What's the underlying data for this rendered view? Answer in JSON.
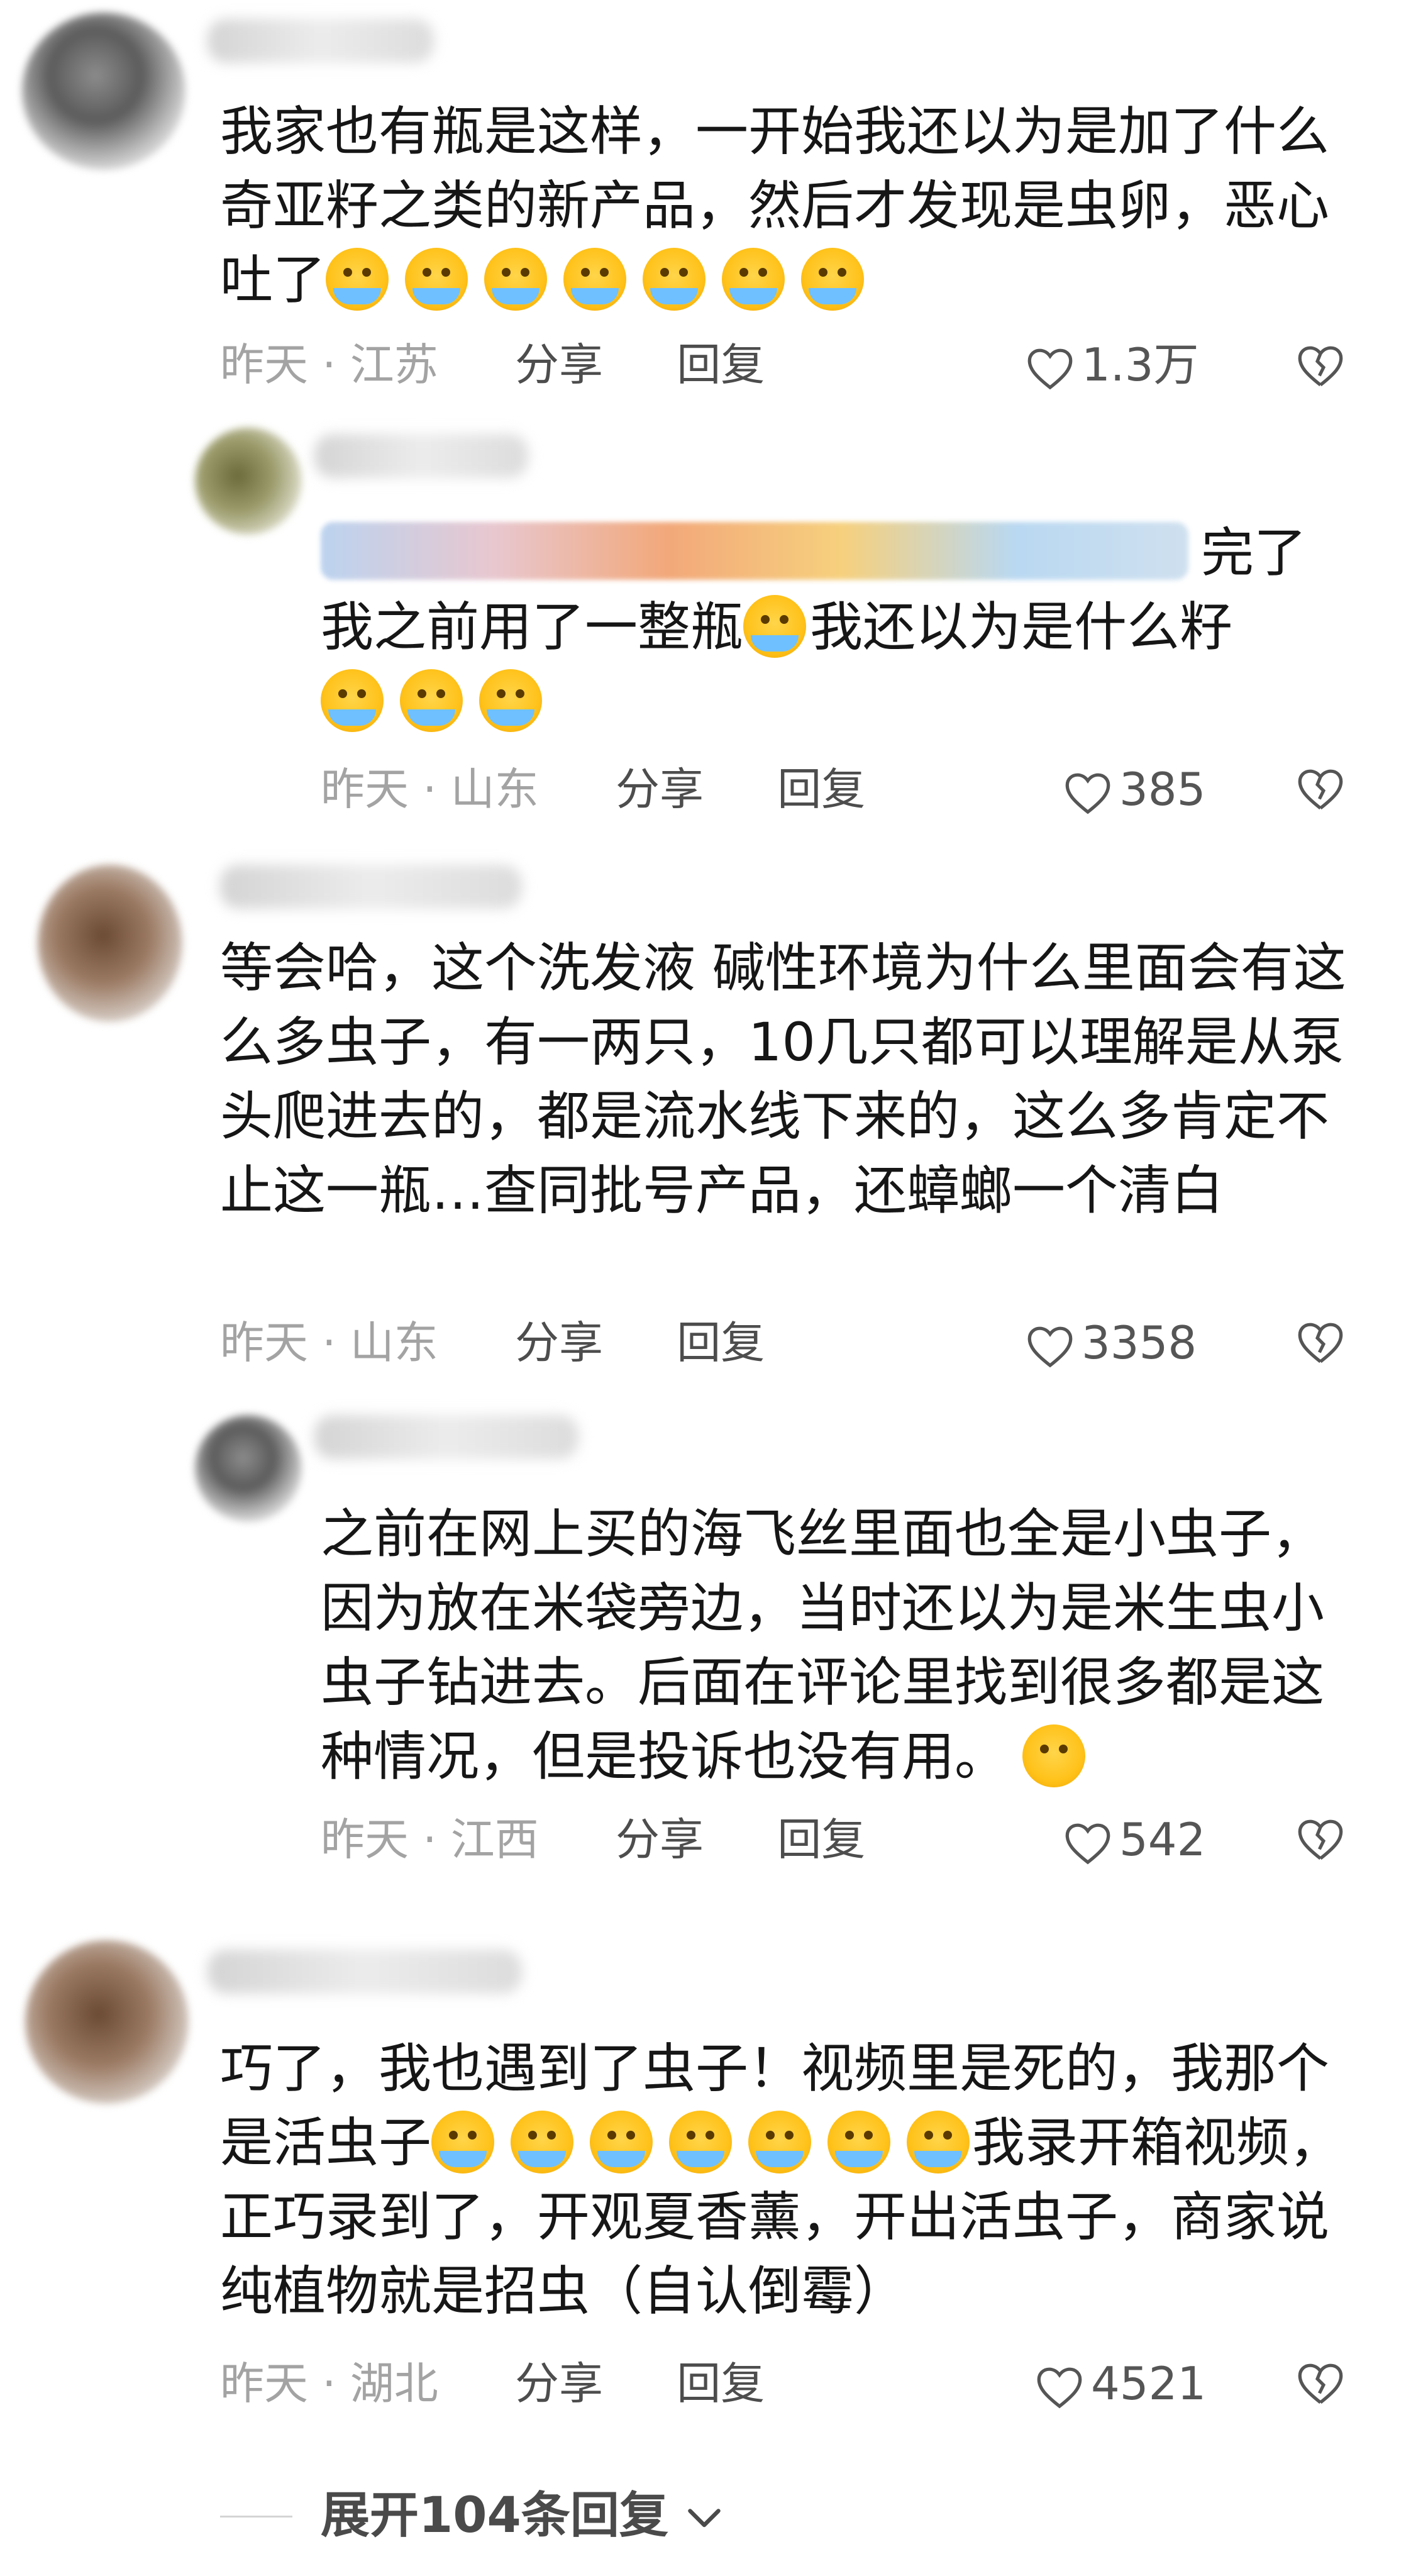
{
  "comments": [
    {
      "text": "我家也有瓶是这样，一开始我还以为是加了什么奇亚籽之类的新产品，然后才发现是虫卵，恶心吐了",
      "emoji_count": 7,
      "time_loc": "昨天 · 江苏",
      "share": "分享",
      "reply": "回复",
      "likes": "1.3万"
    },
    {
      "mention_suffix": "完了",
      "text": "我之前用了一整瓶",
      "text2": "我还以为是什么籽",
      "time_loc": "昨天 · 山东",
      "share": "分享",
      "reply": "回复",
      "likes": "385"
    },
    {
      "text": "等会哈，这个洗发液 碱性环境为什么里面会有这么多虫子，有一两只，10几只都可以理解是从泵头爬进去的，都是流水线下来的，这么多肯定不止这一瓶…查同批号产品，还蟑螂一个清白",
      "time_loc": "昨天 · 山东",
      "share": "分享",
      "reply": "回复",
      "likes": "3358"
    },
    {
      "text": "之前在网上买的海飞丝里面也全是小虫子，因为放在米袋旁边，当时还以为是米生虫小虫子钻进去。后面在评论里找到很多都是这种情况，但是投诉也没有用。",
      "time_loc": "昨天 · 江西",
      "share": "分享",
      "reply": "回复",
      "likes": "542"
    },
    {
      "text": "巧了，我也遇到了虫子！视频里是死的，我那个是活虫子",
      "text2": "我录开箱视频，正巧录到了，开观夏香薰，开出活虫子，商家说纯植物就是招虫（自认倒霉）",
      "time_loc": "昨天 · 湖北",
      "share": "分享",
      "reply": "回复",
      "likes": "4521"
    }
  ],
  "expand": {
    "label": "展开104条回复"
  }
}
